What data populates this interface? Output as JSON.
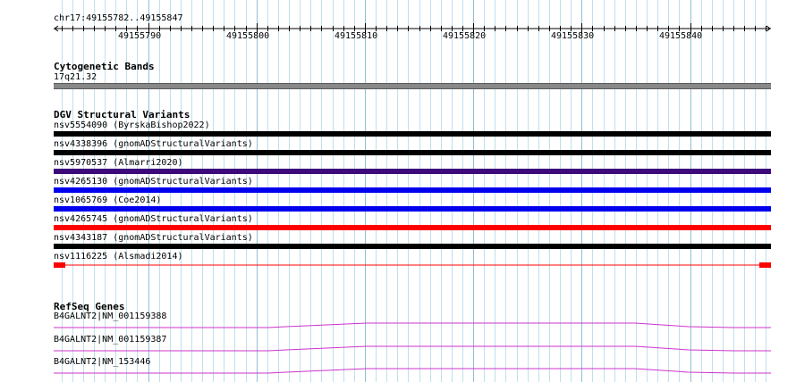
{
  "ruler": {
    "location": "chr17:49155782..49155847",
    "ticks": [
      "49155790",
      "49155800",
      "49155810",
      "49155820",
      "49155830",
      "49155840"
    ]
  },
  "cytobands": {
    "title": "Cytogenetic Bands",
    "band": "17q21.32"
  },
  "dgv": {
    "title": "DGV Structural Variants",
    "variants": [
      {
        "label": "nsv5554090 (ByrskaBishop2022)",
        "color": "#000000"
      },
      {
        "label": "nsv4338396 (gnomADStructuralVariants)",
        "color": "#000000"
      },
      {
        "label": "nsv5970537 (Almarri2020)",
        "color": "#3d0a7a"
      },
      {
        "label": "nsv4265130 (gnomADStructuralVariants)",
        "color": "#0000ee"
      },
      {
        "label": "nsv1065769 (Coe2014)",
        "color": "#0000ee"
      },
      {
        "label": "nsv4265745 (gnomADStructuralVariants)",
        "color": "#ff0000"
      },
      {
        "label": "nsv4343187 (gnomADStructuralVariants)",
        "color": "#000000"
      },
      {
        "label": "nsv1116225 (Alsmadi2014)",
        "color": "#ff0000"
      }
    ]
  },
  "refseq": {
    "title": "RefSeq Genes",
    "genes": [
      {
        "label": "B4GALNT2|NM_001159388",
        "color": "#cc33cc"
      },
      {
        "label": "B4GALNT2|NM_001159387",
        "color": "#cc33cc"
      },
      {
        "label": "B4GALNT2|NM_153446",
        "color": "#cc33cc"
      }
    ]
  }
}
